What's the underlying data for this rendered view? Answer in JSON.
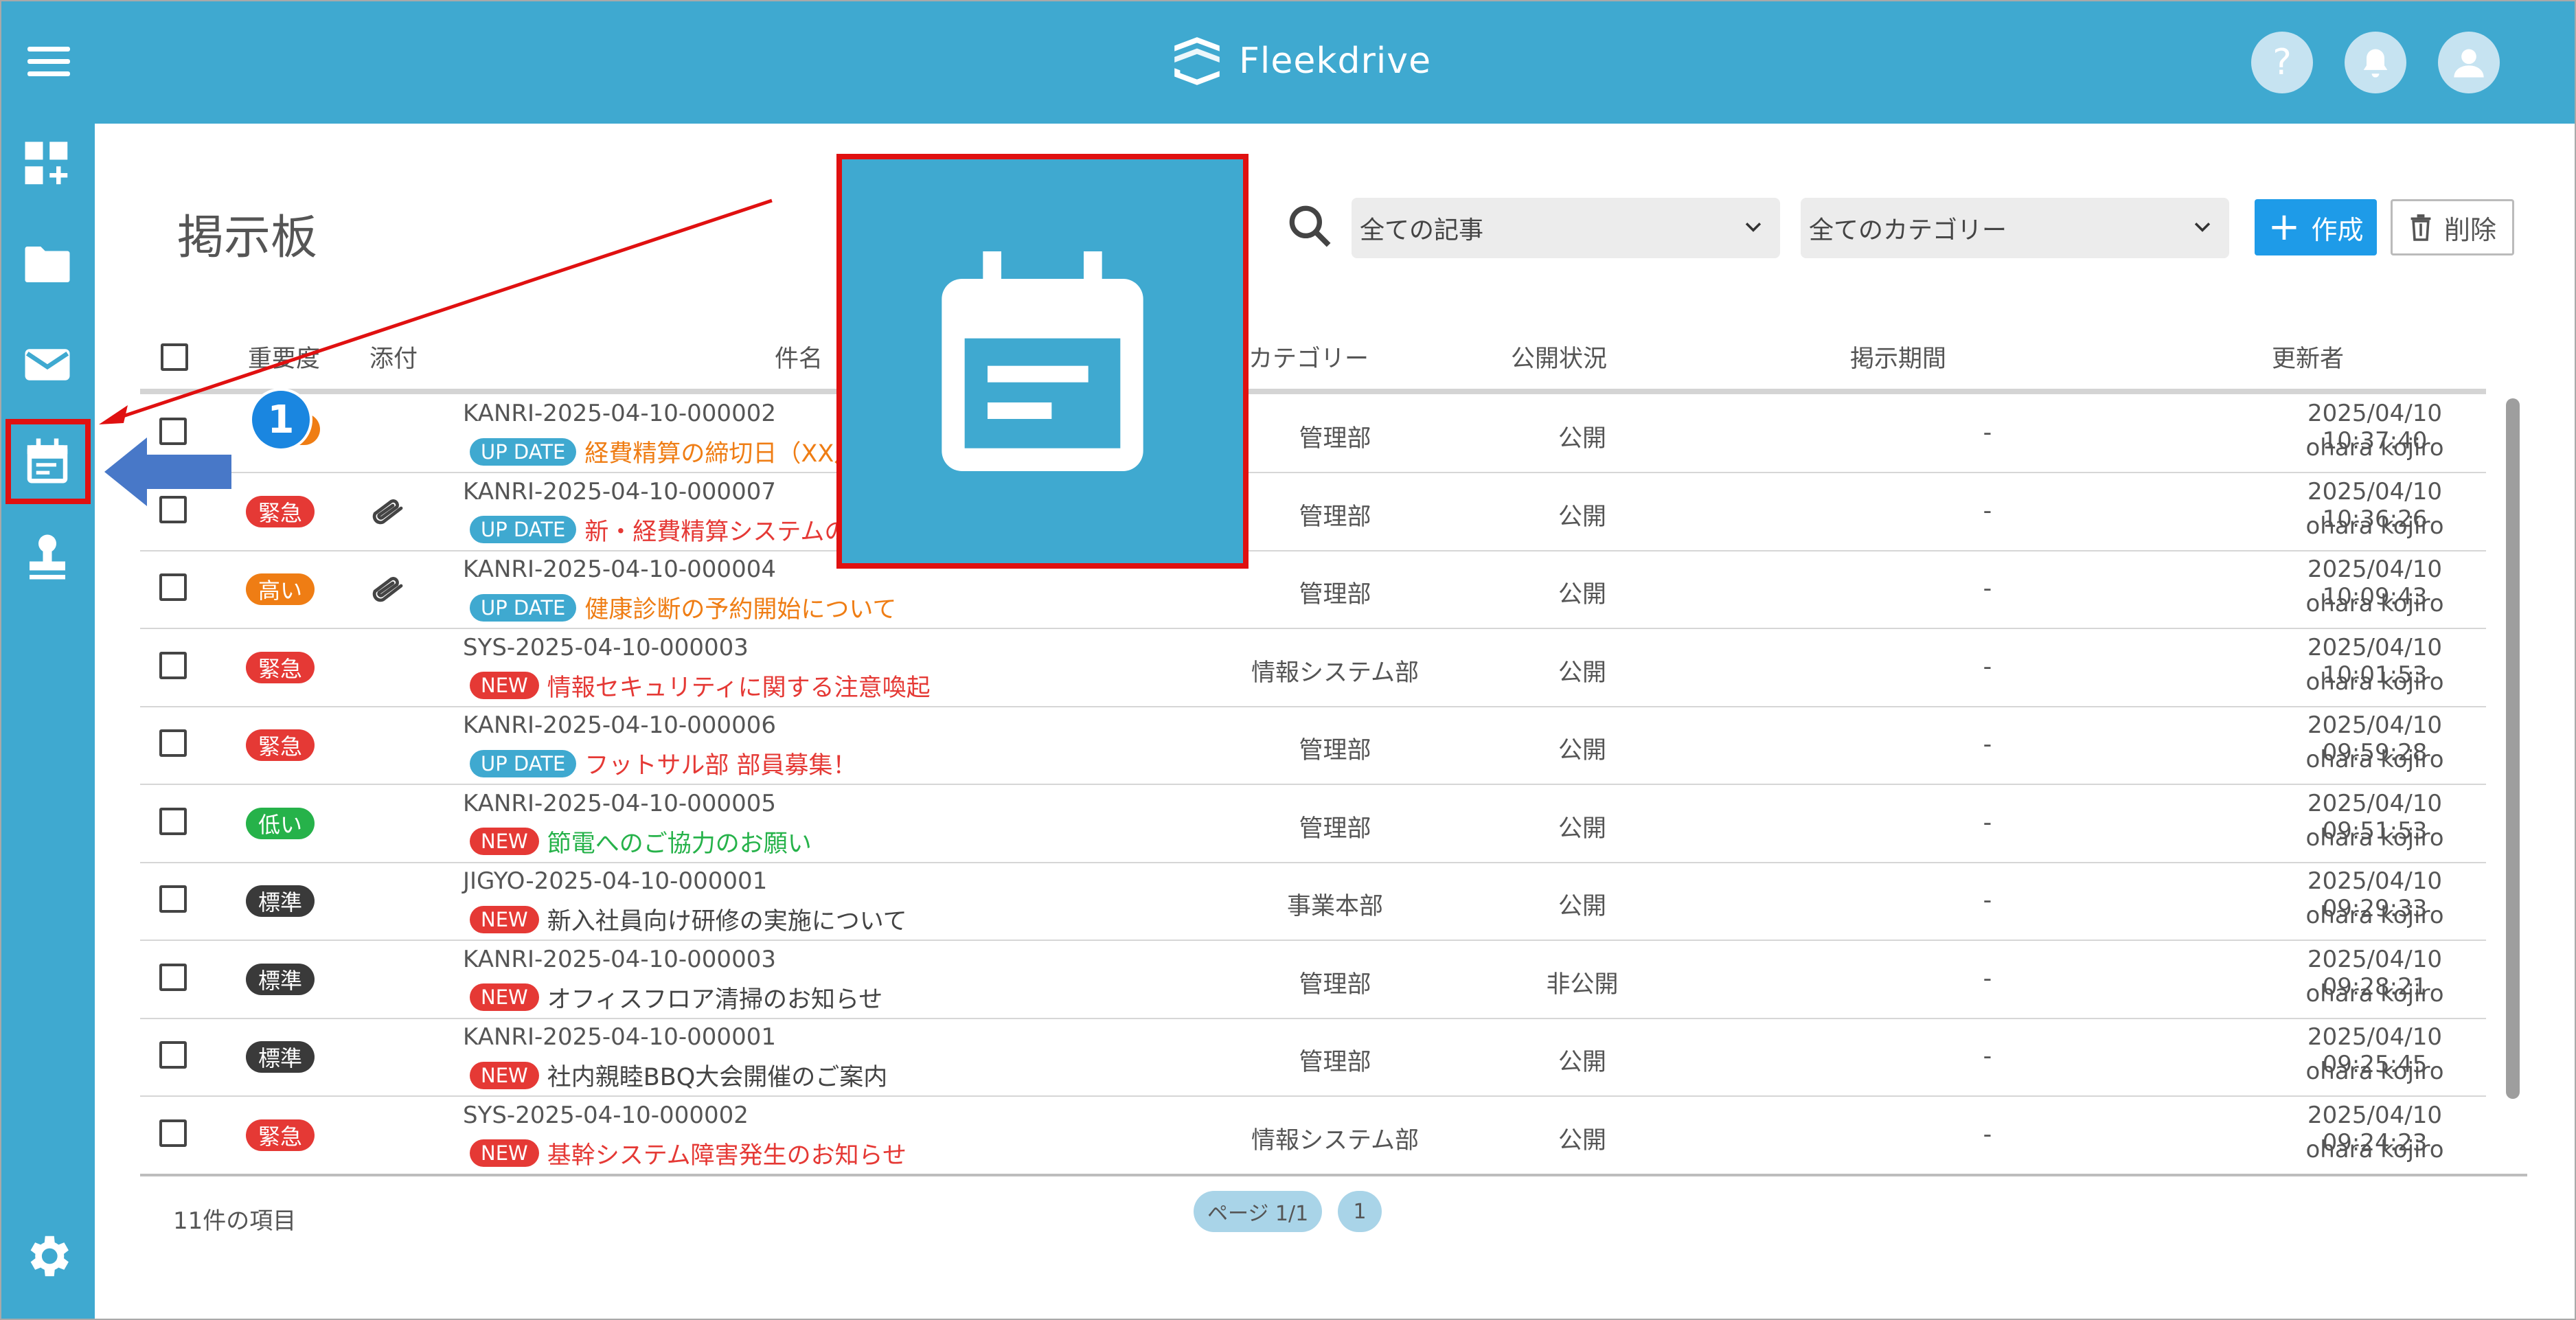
{
  "app": {
    "brand": "Fleekdrive"
  },
  "header": {
    "help_label": "?"
  },
  "page": {
    "title": "掲示板"
  },
  "toolbar": {
    "filter_article": "全ての記事",
    "filter_category": "全てのカテゴリー",
    "create_label": "作成",
    "delete_label": "削除"
  },
  "table": {
    "columns": {
      "importance": "重要度",
      "attachment": "添付",
      "subject": "件名",
      "category": "カテゴリー",
      "status": "公開状況",
      "period": "掲示期間",
      "updater": "更新者"
    },
    "rows": [
      {
        "importance": "",
        "color": "#ef7d14",
        "attach": false,
        "code": "KANRI-2025-04-10-000002",
        "tag": "UP DATE",
        "subject": "経費精算の締切日（XX月",
        "subject_color": "#ef7d14",
        "category": "管理部",
        "status": "公開",
        "period": "-",
        "datetime": "2025/04/10 10:37:40",
        "user": "ohara kojiro"
      },
      {
        "importance": "緊急",
        "color": "#e53935",
        "attach": true,
        "code": "KANRI-2025-04-10-000007",
        "tag": "UP DATE",
        "subject": "新・経費精算システムの",
        "subject_color": "#e53935",
        "category": "管理部",
        "status": "公開",
        "period": "-",
        "datetime": "2025/04/10 10:36:26",
        "user": "ohara kojiro"
      },
      {
        "importance": "高い",
        "color": "#ef7d14",
        "attach": true,
        "code": "KANRI-2025-04-10-000004",
        "tag": "UP DATE",
        "subject": "健康診断の予約開始について",
        "subject_color": "#ef7d14",
        "category": "管理部",
        "status": "公開",
        "period": "-",
        "datetime": "2025/04/10 10:09:43",
        "user": "ohara kojiro"
      },
      {
        "importance": "緊急",
        "color": "#e53935",
        "attach": false,
        "code": "SYS-2025-04-10-000003",
        "tag": "NEW",
        "subject": "情報セキュリティに関する注意喚起",
        "subject_color": "#e53935",
        "category": "情報システム部",
        "status": "公開",
        "period": "-",
        "datetime": "2025/04/10 10:01:53",
        "user": "ohara kojiro"
      },
      {
        "importance": "緊急",
        "color": "#e53935",
        "attach": false,
        "code": "KANRI-2025-04-10-000006",
        "tag": "UP DATE",
        "subject": "フットサル部 部員募集！",
        "subject_color": "#e53935",
        "category": "管理部",
        "status": "公開",
        "period": "-",
        "datetime": "2025/04/10 09:59:28",
        "user": "ohara kojiro"
      },
      {
        "importance": "低い",
        "color": "#26b24a",
        "attach": false,
        "code": "KANRI-2025-04-10-000005",
        "tag": "NEW",
        "subject": "節電へのご協力のお願い",
        "subject_color": "#26b24a",
        "category": "管理部",
        "status": "公開",
        "period": "-",
        "datetime": "2025/04/10 09:51:53",
        "user": "ohara kojiro"
      },
      {
        "importance": "標準",
        "color": "#3a3a3a",
        "attach": false,
        "code": "JIGYO-2025-04-10-000001",
        "tag": "NEW",
        "subject": "新入社員向け研修の実施について",
        "subject_color": "#444444",
        "category": "事業本部",
        "status": "公開",
        "period": "-",
        "datetime": "2025/04/10 09:29:33",
        "user": "ohara kojiro"
      },
      {
        "importance": "標準",
        "color": "#3a3a3a",
        "attach": false,
        "code": "KANRI-2025-04-10-000003",
        "tag": "NEW",
        "subject": "オフィスフロア清掃のお知らせ",
        "subject_color": "#444444",
        "category": "管理部",
        "status": "非公開",
        "period": "-",
        "datetime": "2025/04/10 09:28:21",
        "user": "ohara kojiro"
      },
      {
        "importance": "標準",
        "color": "#3a3a3a",
        "attach": false,
        "code": "KANRI-2025-04-10-000001",
        "tag": "NEW",
        "subject": "社内親睦BBQ大会開催のご案内",
        "subject_color": "#444444",
        "category": "管理部",
        "status": "公開",
        "period": "-",
        "datetime": "2025/04/10 09:25:45",
        "user": "ohara kojiro"
      },
      {
        "importance": "緊急",
        "color": "#e53935",
        "attach": false,
        "code": "SYS-2025-04-10-000002",
        "tag": "NEW",
        "subject": "基幹システム障害発生のお知らせ",
        "subject_color": "#e53935",
        "category": "情報システム部",
        "status": "公開",
        "period": "-",
        "datetime": "2025/04/10 09:24:23",
        "user": "ohara kojiro"
      }
    ]
  },
  "footer": {
    "count": "11件の項目",
    "page_label": "ページ 1/1",
    "page_number": "1"
  },
  "annotation": {
    "step": "1"
  },
  "colors": {
    "primary": "#3fa9d0",
    "accent": "#1e9be8",
    "highlight": "#e01010"
  },
  "icons": {
    "sidebar": [
      "dashboard-add-icon",
      "folder-icon",
      "mail-icon",
      "bulletin-board-icon",
      "stamp-icon",
      "gear-icon"
    ],
    "header": [
      "help-icon",
      "bell-icon",
      "user-icon"
    ]
  }
}
